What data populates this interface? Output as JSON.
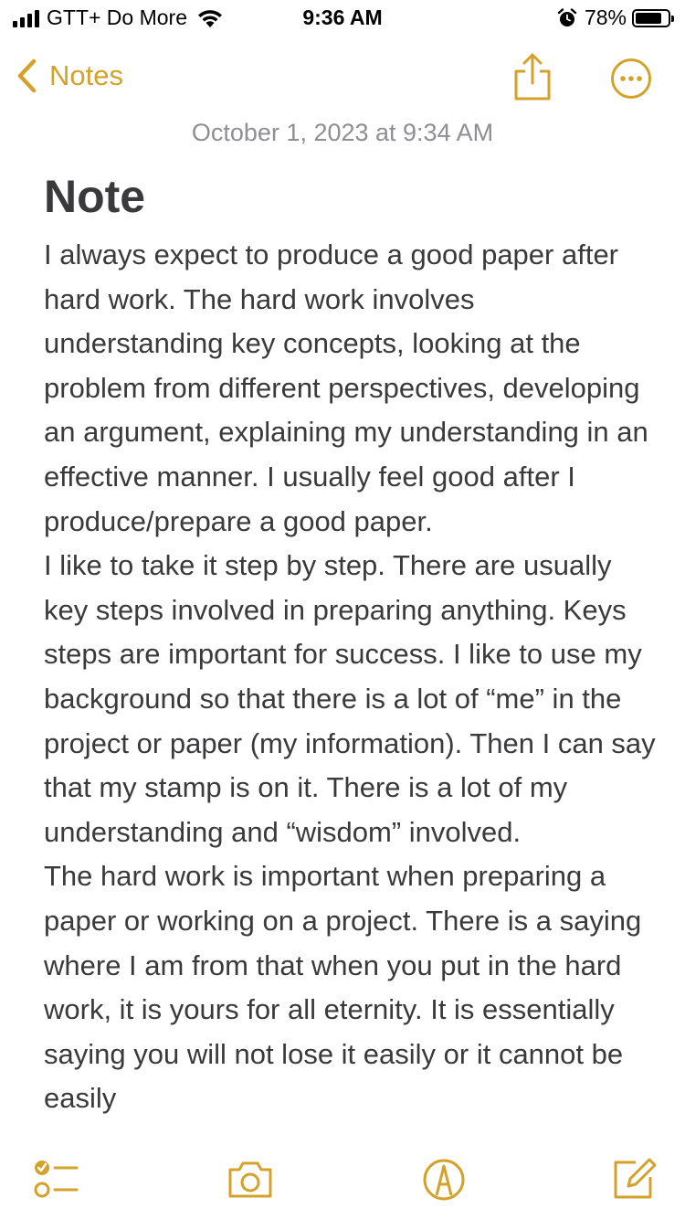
{
  "status_bar": {
    "carrier": "GTT+ Do More",
    "time": "9:36 AM",
    "battery": "78%"
  },
  "nav": {
    "back_label": "Notes",
    "share_icon": "share-icon",
    "more_icon": "more-icon"
  },
  "note": {
    "date": "October 1, 2023 at 9:34 AM",
    "title": "Note",
    "paragraphs": [
      "I always expect to produce a good paper after hard work. The hard work involves understanding key concepts, looking at the problem from different perspectives, developing an argument, explaining my understanding in an effective manner. I usually feel good after I produce/prepare a good paper.",
      "I like to take it step by step. There are usually key steps involved in preparing anything. Keys steps are important for success. I like to use my background so that there is a lot of “me” in the project or paper (my information). Then I can say that my stamp is on it. There is a lot of my understanding and “wisdom” involved.",
      "The hard work is important when preparing a paper or working on a project. There is a saying where I am from that when you put in the hard work, it is yours for all eternity. It is essentially saying you will not lose it easily or it cannot be easily"
    ]
  },
  "toolbar": {
    "items": [
      "checklist-icon",
      "camera-icon",
      "markup-icon",
      "compose-icon"
    ]
  },
  "colors": {
    "accent": "#d4a22a",
    "text": "#3a3a3c",
    "secondary": "#8e8e93"
  }
}
